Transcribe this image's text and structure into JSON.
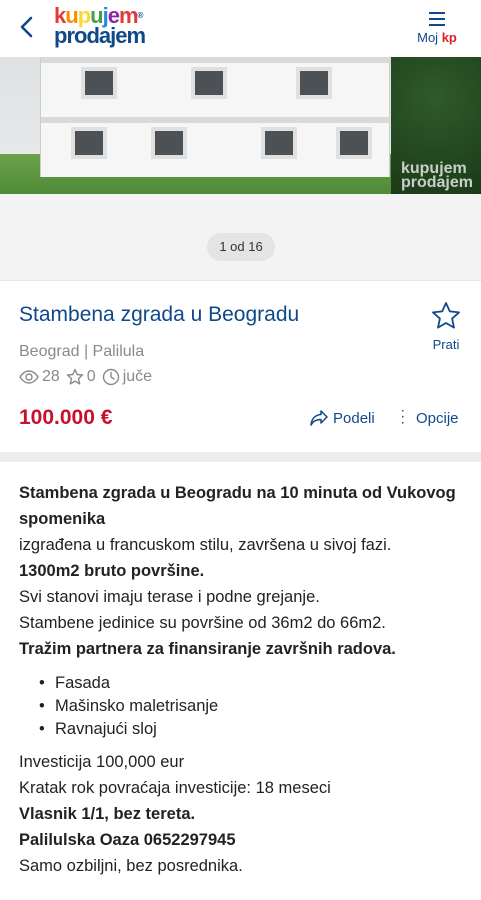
{
  "header": {
    "logo_line1": "kupujem",
    "logo_line2": "prodajem",
    "menu_label_prefix": "Moj ",
    "menu_label_brand": "kp",
    "brand_red": "#d8232a",
    "brand_blue": "#10498a"
  },
  "gallery": {
    "watermark_line1": "kupujem",
    "watermark_line2": "prodajem",
    "counter": "1 od 16"
  },
  "listing": {
    "title": "Stambena zgrada u Beogradu",
    "save_label": "Prati",
    "location": "Beograd | Palilula",
    "views": "28",
    "favorites": "0",
    "posted": "juče",
    "price": "100.000 €",
    "share_label": "Podeli",
    "options_label": "Opcije"
  },
  "description": {
    "heading": "Stambena zgrada u Beogradu na 10 minuta od Vukovog spomenika",
    "line1": "izgrađena u francuskom stilu, završena u sivoj fazi.",
    "line2": "1300m2 bruto površine.",
    "line3": "Svi stanovi imaju terase i podne grejanje.",
    "line4": "Stambene jedinice su površine od 36m2 do 66m2.",
    "line5": "Tražim partnera za finansiranje završnih radova.",
    "items": [
      "Fasada",
      "Mašinsko maletrisanje",
      "Ravnajući sloj"
    ],
    "line6": "Investicija 100,000 eur",
    "line7": "Kratak rok povraćaja investicije: 18 meseci",
    "line8": "Vlasnik 1/1, bez tereta.",
    "line9": "Palilulska Oaza 0652297945",
    "line10": "Samo ozbiljni, bez posrednika."
  }
}
